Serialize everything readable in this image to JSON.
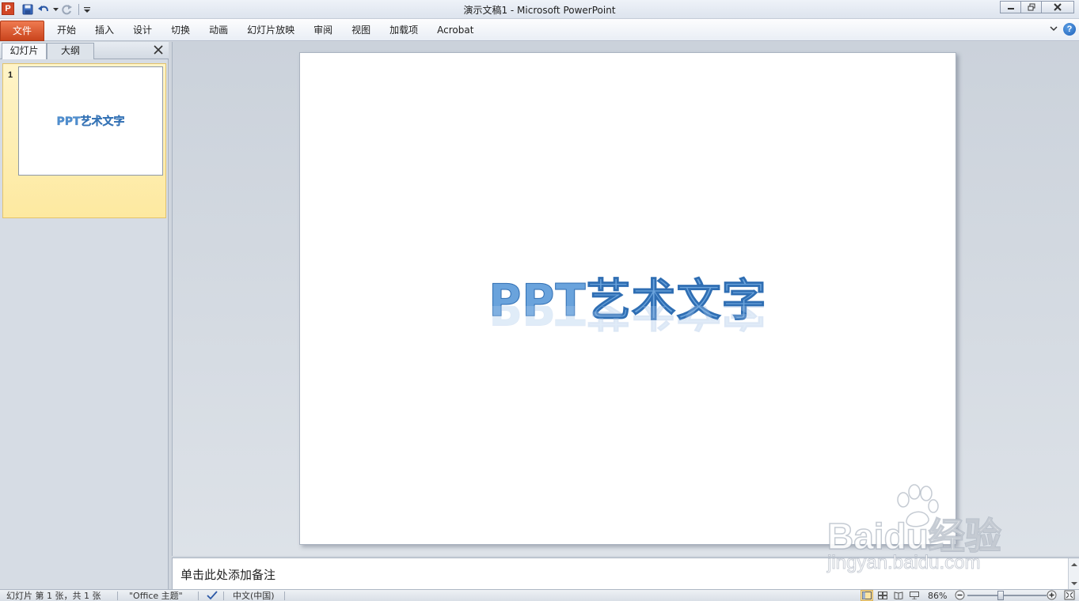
{
  "window": {
    "title": "演示文稿1  -  Microsoft PowerPoint",
    "app_icon_letter": "P"
  },
  "ribbon": {
    "file_tab": "文件",
    "tabs": [
      "开始",
      "插入",
      "设计",
      "切换",
      "动画",
      "幻灯片放映",
      "审阅",
      "视图",
      "加载项",
      "Acrobat"
    ]
  },
  "left_pane": {
    "tab_slides": "幻灯片",
    "tab_outline": "大纲",
    "slides": [
      {
        "number": "1",
        "thumbnail_text": "PPT艺术文字"
      }
    ]
  },
  "slide": {
    "wordart_text": "PPT艺术文字"
  },
  "notes": {
    "placeholder": "单击此处添加备注"
  },
  "statusbar": {
    "slide_info": "幻灯片 第 1 张，共 1 张",
    "theme": "\"Office 主题\"",
    "language": "中文(中国)",
    "zoom": "86%"
  },
  "watermark": {
    "logo": "Baidu经验",
    "sub": "jingyan.baidu.com"
  },
  "colors": {
    "file_tab": "#d24726",
    "wordart_fill": "#6aa3dc",
    "wordart_stroke": "#2f6eb3",
    "selected_thumb": "#fde9a0"
  }
}
